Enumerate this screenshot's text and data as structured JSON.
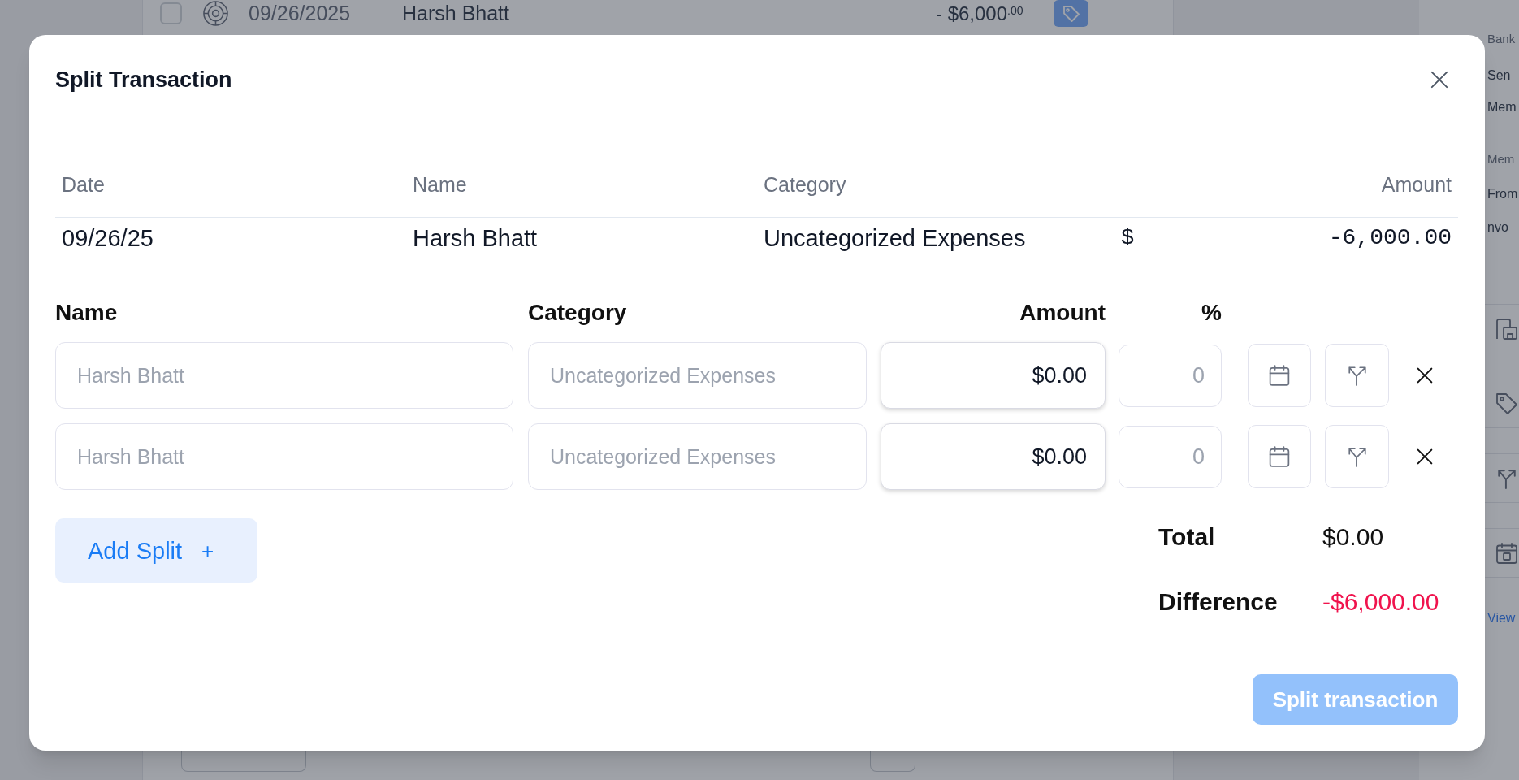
{
  "background": {
    "transaction_row": {
      "checked": false,
      "date": "09/26/2025",
      "name": "Harsh Bhatt",
      "amount": "- $6,000$^{.00}$"
    },
    "details_panel": {
      "bank_label": "Bank",
      "bank_lines": [
        "Sen",
        "Mem"
      ],
      "memo_label": "Mem",
      "memo_lines": [
        "From",
        "nvo"
      ],
      "link": "View"
    }
  },
  "dialog": {
    "title": "Split Transaction",
    "transaction": {
      "columns": [
        "Date",
        "Name",
        "Category",
        "Amount"
      ],
      "date": "09/26/25",
      "name": "Harsh Bhatt",
      "category": "Uncategorized Expenses",
      "currency": "$",
      "amount": "-6,000.00"
    },
    "splits": {
      "columns": [
        "Name",
        "Category",
        "Amount",
        "%"
      ],
      "rows": [
        {
          "name": {
            "placeholder": "Harsh Bhatt"
          },
          "category": {
            "placeholder": "Uncategorized Expenses"
          },
          "amount": {
            "value": "$0.00"
          },
          "percent": {
            "placeholder": "0"
          }
        },
        {
          "name": {
            "placeholder": "Harsh Bhatt"
          },
          "category": {
            "placeholder": "Uncategorized Expenses"
          },
          "amount": {
            "value": "$0.00"
          },
          "percent": {
            "placeholder": "0"
          }
        }
      ]
    },
    "add_button": {
      "label": "Add Split",
      "symbol": "+"
    },
    "totals": [
      {
        "label": "Total",
        "value": "$0.00",
        "kind": "plain"
      },
      {
        "label": "Difference",
        "value": "-$6,000.00",
        "kind": "negative"
      }
    ],
    "submit": {
      "label": "Split transaction",
      "disabled": true
    }
  }
}
